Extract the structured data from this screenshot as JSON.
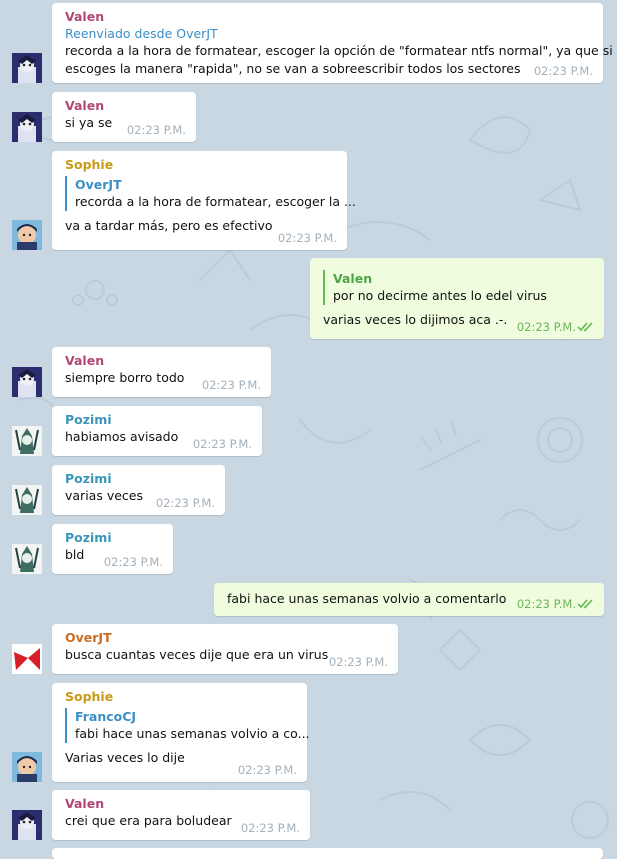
{
  "colors": {
    "Valen": "#b24776",
    "Sophie": "#c89a17",
    "Pozimi": "#3a96b9",
    "OverJT": "#c96b20",
    "wallpaper": "#c9d7e2",
    "incoming_bubble": "#ffffff",
    "outgoing_bubble": "#effdde"
  },
  "messages": [
    {
      "sender": "Valen",
      "forwarded": "Reenviado desde OverJT",
      "text_lines": [
        "recorda a la hora de formatear, escoger la opción de \"formatear ntfs normal\", ya que si",
        "escoges la manera \"rapida\", no se van a sobreescribir todos los sectores"
      ],
      "time": "02:23 P.M."
    },
    {
      "sender": "Valen",
      "text": "si ya se",
      "time": "02:23 P.M."
    },
    {
      "sender": "Sophie",
      "reply_to": {
        "name": "OverJT",
        "text": "recorda a la hora de formatear, escoger la ..."
      },
      "text": "va a tardar más, pero es efectivo",
      "time": "02:23 P.M."
    },
    {
      "outgoing": true,
      "reply_to": {
        "name": "Valen",
        "text": "por no decirme antes lo edel virus"
      },
      "text": "varias veces lo dijimos aca .-.",
      "time": "02:23 P.M.",
      "status_icon": "double-check-icon"
    },
    {
      "sender": "Valen",
      "text": "siempre borro todo",
      "time": "02:23 P.M."
    },
    {
      "sender": "Pozimi",
      "text": "habiamos avisado",
      "time": "02:23 P.M."
    },
    {
      "sender": "Pozimi",
      "text": "varias veces",
      "time": "02:23 P.M."
    },
    {
      "sender": "Pozimi",
      "text": "bld",
      "time": "02:23 P.M."
    },
    {
      "outgoing": true,
      "text": "fabi hace unas semanas volvio a comentarlo",
      "time": "02:23 P.M.",
      "status_icon": "double-check-icon"
    },
    {
      "sender": "OverJT",
      "text": "busca cuantas veces dije que era un virus",
      "time": "02:23 P.M."
    },
    {
      "sender": "Sophie",
      "reply_to": {
        "name": "FrancoCJ",
        "text": "fabi hace unas semanas volvio a co..."
      },
      "text": "Varias veces lo dije",
      "time": "02:23 P.M."
    },
    {
      "sender": "Valen",
      "text": "crei que era para boludear",
      "time": "02:23 P.M."
    }
  ]
}
